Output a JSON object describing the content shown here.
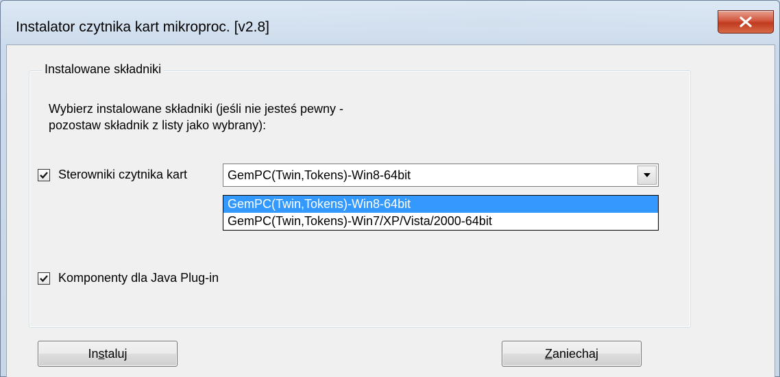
{
  "window": {
    "title": "Instalator czytnika kart mikroproc. [v2.8]",
    "close_icon": "close-x-icon"
  },
  "group": {
    "legend": "Instalowane składniki",
    "instructions": "Wybierz instalowane składniki (jeśli nie jesteś pewny -\npozostaw składnik z listy jako wybrany):"
  },
  "drivers": {
    "checked": true,
    "label": "Sterowniki czytnika kart",
    "selected_value": "GemPC(Twin,Tokens)-Win8-64bit",
    "options": [
      "GemPC(Twin,Tokens)-Win8-64bit",
      "GemPC(Twin,Tokens)-Win7/XP/Vista/2000-64bit"
    ]
  },
  "java": {
    "checked": true,
    "label": "Komponenty dla Java Plug-in"
  },
  "buttons": {
    "install": {
      "pre": "In",
      "accel": "s",
      "post": "taluj"
    },
    "cancel": {
      "pre": "",
      "accel": "Z",
      "post": "aniechaj"
    }
  },
  "colors": {
    "selection": "#3399ff",
    "close_button": "#c8452b"
  }
}
